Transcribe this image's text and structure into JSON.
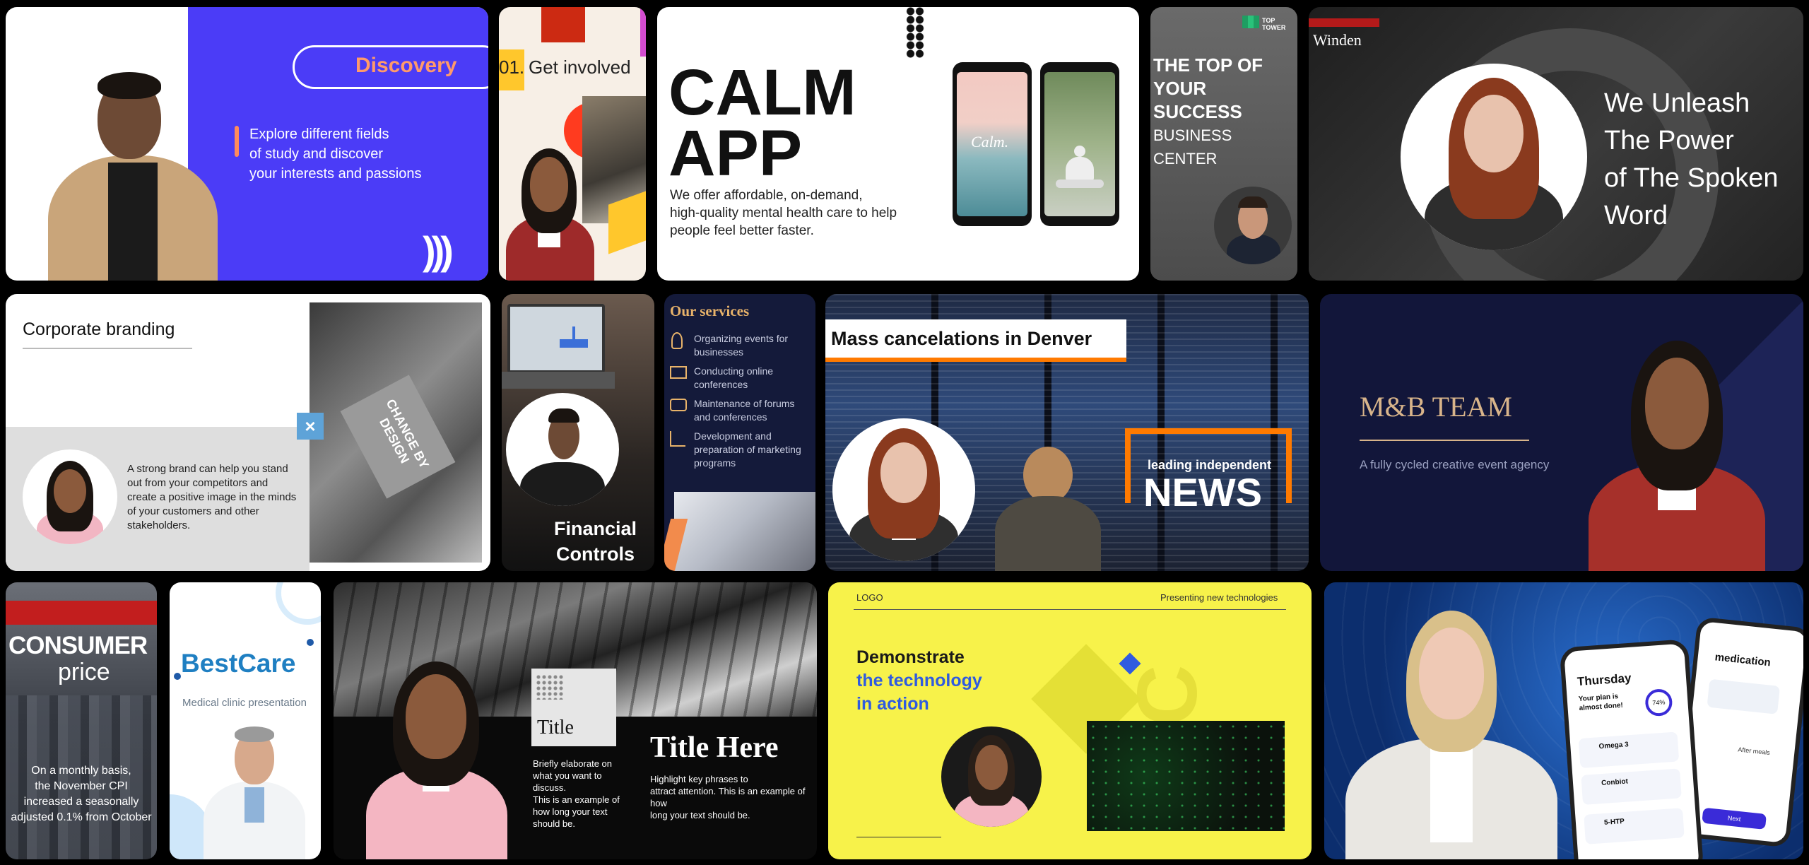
{
  "tiles": {
    "discovery": {
      "title": "Discovery",
      "line1": "Explore different fields",
      "line2": "of study and discover",
      "line3": "your interests and passions",
      "accent": "#4b3cf7"
    },
    "involved": {
      "number": "01.",
      "title": "Get involved"
    },
    "calm": {
      "title1": "CALM",
      "title2": "APP",
      "desc1": "We offer affordable, on-demand,",
      "desc2": "high-quality mental health care to help",
      "desc3": "people feel better faster.",
      "phone_label": "Calm."
    },
    "tower": {
      "logo": "TOP TOWER",
      "l1": "THE TOP OF",
      "l2": "YOUR",
      "l3": "SUCCESS",
      "l4": "BUSINESS CENTER"
    },
    "winden": {
      "brand": "Winden",
      "l1": "We Unleash",
      "l2": "The Power",
      "l3": "of The Spoken",
      "l4": "Word"
    },
    "branding": {
      "title": "Corporate branding",
      "t1": "A strong brand can help you stand",
      "t2": "out from your competitors and",
      "t3": "create a positive image in the minds",
      "t4": "of your customers and other",
      "t5": "stakeholders.",
      "book": "CHANGE BY DESIGN"
    },
    "financial": {
      "l1": "Financial",
      "l2": "Controls"
    },
    "services": {
      "title": "Our services",
      "items": [
        {
          "a": "Organizing events for",
          "b": "businesses"
        },
        {
          "a": "Conducting online",
          "b": "conferences"
        },
        {
          "a": "Maintenance of forums",
          "b": "and conferences"
        },
        {
          "a": "Development and",
          "b": "preparation of marketing",
          "c": "programs"
        }
      ]
    },
    "news": {
      "headline": "Mass cancelations in Denver",
      "sub": "leading independent",
      "big": "NEWS"
    },
    "mb": {
      "title": "M&B TEAM",
      "sub": "A fully cycled creative event agency"
    },
    "consumer": {
      "l1": "CONSUMER",
      "l2": "price",
      "b1": "On a monthly basis,",
      "b2": "the November CPI",
      "b3": "increased a seasonally",
      "b4": "adjusted 0.1% from October"
    },
    "bestcare": {
      "title": "BestCare",
      "sub": "Medical clinic presentation"
    },
    "titlehere": {
      "small_title": "Title",
      "s1": "Briefly elaborate on",
      "s2": "what you want to",
      "s3": "discuss.",
      "s4": "This is an example of",
      "s5": "how long your text",
      "s6": "should be.",
      "big_title": "Title Here",
      "b1": "Highlight key phrases to",
      "b2": "attract attention. This is an example of how",
      "b3": "long your text should be."
    },
    "tech": {
      "logo": "LOGO",
      "right": "Presenting new technologies",
      "l1": "Demonstrate",
      "l2": "the technology",
      "l3": "in action"
    },
    "app": {
      "front_day": "Thursday",
      "front_plan": "Your plan is almost done!",
      "front_pct": "74%",
      "item1": "Omega 3",
      "item2": "Conbiot",
      "item3": "5-HTP",
      "back_title": "medication",
      "back_tag": "After meals",
      "back_btn": "Next"
    }
  }
}
